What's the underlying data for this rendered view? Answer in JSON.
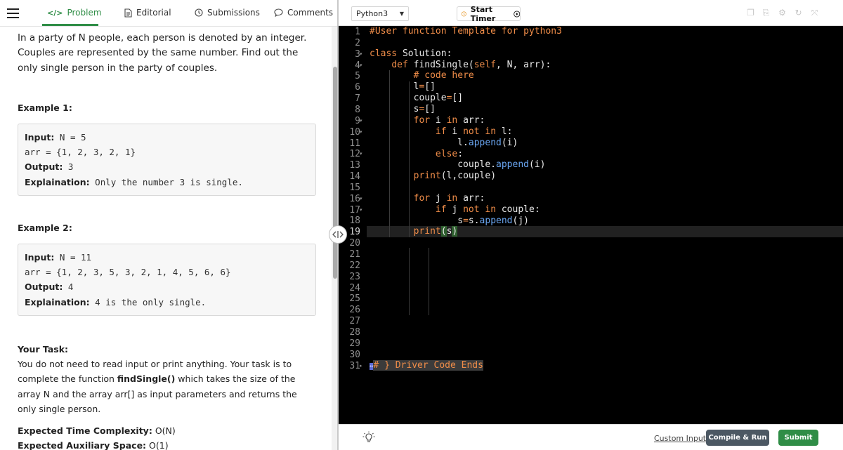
{
  "nav": {
    "tabs": [
      {
        "label": "Problem",
        "icon": "code-icon",
        "active": true
      },
      {
        "label": "Editorial",
        "icon": "document-icon"
      },
      {
        "label": "Submissions",
        "icon": "clock-icon"
      },
      {
        "label": "Comments",
        "icon": "chat-bubble-icon"
      }
    ]
  },
  "problem": {
    "statement": "In a party of N people, each person is denoted by an integer. Couples are represented by the same number. Find out the only single person in the party of couples.",
    "example1": {
      "heading": "Example 1:",
      "input_label": "Input:",
      "input_value": "N = 5",
      "arr": "arr = {1, 2, 3, 2, 1}",
      "output_label": "Output:",
      "output_value": "3",
      "explain_label": "Explaination:",
      "explain_value": "Only the number 3 is single."
    },
    "example2": {
      "heading": "Example 2:",
      "input_label": "Input:",
      "input_value": "N = 11",
      "arr": "arr = {1, 2, 3, 5, 3, 2, 1, 4, 5, 6, 6}",
      "output_label": "Output:",
      "output_value": "4",
      "explain_label": "Explaination:",
      "explain_value": "4 is the only single."
    },
    "task": {
      "heading": "Your Task:",
      "text_before": "You do not need to read input or print anything. Your task is to complete the function ",
      "function_name": "findSingle()",
      "text_after": " which takes the size of the array N and the array arr[] as input parameters and returns the only single person."
    },
    "time_complexity": {
      "label": "Expected Time Complexity:",
      "value": "O(N)"
    },
    "space_complexity": {
      "label": "Expected Auxiliary Space:",
      "value": "O(1)"
    }
  },
  "editor": {
    "language": "Python3",
    "timer_label": "Start Timer",
    "toolbar_icons": [
      "copy-icon",
      "export-icon",
      "settings-icon",
      "reset-icon",
      "fullscreen-icon"
    ],
    "line_numbers": [
      "1",
      "2",
      "3",
      "4",
      "5",
      "6",
      "7",
      "8",
      "9",
      "10",
      "11",
      "12",
      "13",
      "14",
      "15",
      "16",
      "17",
      "18",
      "19",
      "20",
      "21",
      "22",
      "23",
      "24",
      "25",
      "26",
      "27",
      "28",
      "29",
      "30",
      "31"
    ],
    "active_line": "19",
    "collapsed_marker": "↔",
    "code_last_line": "# } Driver Code Ends"
  },
  "bottom": {
    "custom_input": "Custom Input",
    "compile": "Compile & Run",
    "submit": "Submit"
  },
  "colors": {
    "brand_green": "#2f8d46",
    "editor_bg": "#000000",
    "keyword": "#f08d49",
    "function_call": "#6aa6f2",
    "compile_button": "#4c5863"
  }
}
